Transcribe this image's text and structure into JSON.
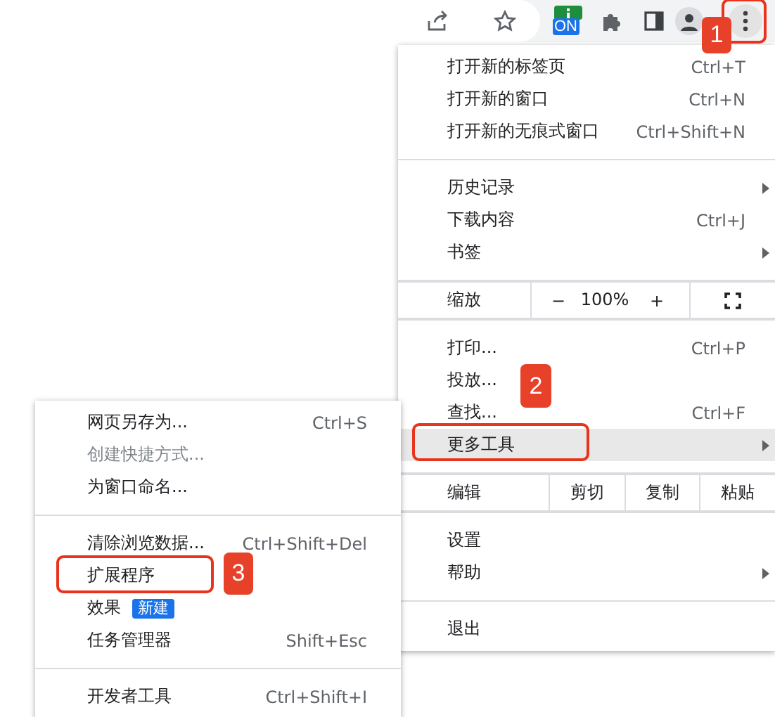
{
  "toolbar": {
    "extension_badge": "ON",
    "menu_button": {
      "callout": "1"
    }
  },
  "menu": {
    "items": [
      {
        "kind": "item",
        "label": "打开新的标签页",
        "shortcut": "Ctrl+T",
        "selected": false
      },
      {
        "kind": "item",
        "label": "打开新的窗口",
        "shortcut": "Ctrl+N",
        "selected": false
      },
      {
        "kind": "item",
        "label": "打开新的无痕式窗口",
        "shortcut": "Ctrl+Shift+N",
        "selected": false
      },
      {
        "kind": "separator"
      },
      {
        "kind": "item",
        "label": "历史记录",
        "submenu": true,
        "selected": false
      },
      {
        "kind": "item",
        "label": "下载内容",
        "shortcut": "Ctrl+J",
        "selected": false
      },
      {
        "kind": "item",
        "label": "书签",
        "submenu": true,
        "selected": false
      },
      {
        "kind": "separator"
      },
      {
        "kind": "zoom",
        "label": "缩放",
        "minus": "−",
        "value": "100%",
        "plus": "+"
      },
      {
        "kind": "separator"
      },
      {
        "kind": "item",
        "label": "打印...",
        "shortcut": "Ctrl+P",
        "selected": false
      },
      {
        "kind": "item",
        "label": "投放...",
        "selected": false
      },
      {
        "kind": "item",
        "label": "查找...",
        "shortcut": "Ctrl+F",
        "selected": false
      },
      {
        "kind": "item",
        "label": "更多工具",
        "submenu": true,
        "selected": true,
        "callout": "2"
      },
      {
        "kind": "separator"
      },
      {
        "kind": "edit",
        "label": "编辑",
        "actions": [
          "剪切",
          "复制",
          "粘贴"
        ]
      },
      {
        "kind": "separator"
      },
      {
        "kind": "item",
        "label": "设置",
        "selected": false
      },
      {
        "kind": "item",
        "label": "帮助",
        "submenu": true,
        "selected": false
      },
      {
        "kind": "separator"
      },
      {
        "kind": "item",
        "label": "退出",
        "selected": false
      }
    ]
  },
  "submenu": {
    "items": [
      {
        "kind": "item",
        "label": "网页另存为...",
        "shortcut": "Ctrl+S",
        "disabled": false
      },
      {
        "kind": "item",
        "label": "创建快捷方式...",
        "disabled": true
      },
      {
        "kind": "item",
        "label": "为窗口命名...",
        "disabled": false
      },
      {
        "kind": "separator"
      },
      {
        "kind": "item",
        "label": "清除浏览数据...",
        "shortcut": "Ctrl+Shift+Del",
        "disabled": false
      },
      {
        "kind": "item",
        "label": "扩展程序",
        "disabled": false,
        "callout": "3"
      },
      {
        "kind": "item",
        "label": "效果",
        "badge": "新建",
        "disabled": false
      },
      {
        "kind": "item",
        "label": "任务管理器",
        "shortcut": "Shift+Esc",
        "disabled": false
      },
      {
        "kind": "separator"
      },
      {
        "kind": "item",
        "label": "开发者工具",
        "shortcut": "Ctrl+Shift+I",
        "disabled": false
      }
    ]
  }
}
